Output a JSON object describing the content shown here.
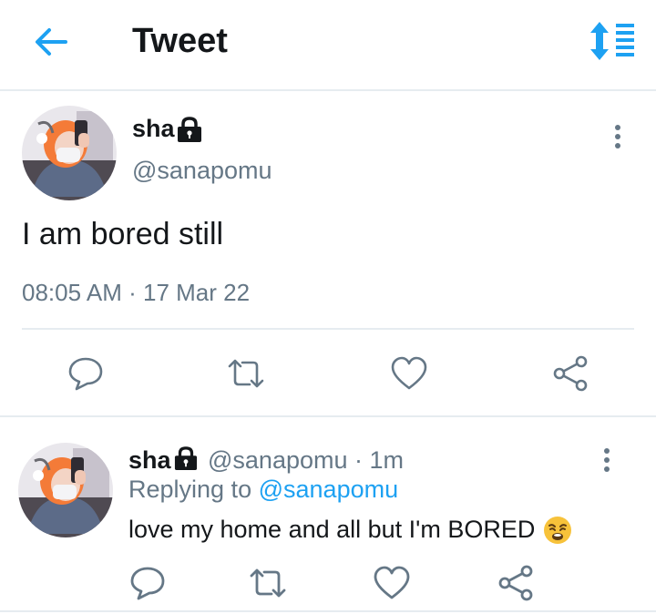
{
  "header": {
    "title": "Tweet",
    "back_icon": "arrow-left-icon",
    "sort_icon": "sort-icon",
    "accent": "#1da1f2"
  },
  "tweet": {
    "name": "sha",
    "handle": "@sanapomu",
    "text": "I am bored still",
    "time": "08:05 AM",
    "date": "17 Mar 22",
    "separator": "·",
    "protected_icon": "lock-icon",
    "actions": [
      "reply-icon",
      "retweet-icon",
      "like-icon",
      "share-icon"
    ]
  },
  "reply": {
    "name": "sha",
    "handle": "@sanapomu",
    "age": "1m",
    "separator": "·",
    "replying_prefix": "Replying to",
    "replying_to": "@sanapomu",
    "text": "love my home and all but I'm BORED",
    "emoji_icon": "weary-face-emoji",
    "actions": [
      "reply-icon",
      "retweet-icon",
      "like-icon",
      "share-icon"
    ]
  },
  "colors": {
    "text": "#14171a",
    "secondary": "#657786",
    "link": "#1da1f2",
    "divider": "#e6ecf0"
  }
}
